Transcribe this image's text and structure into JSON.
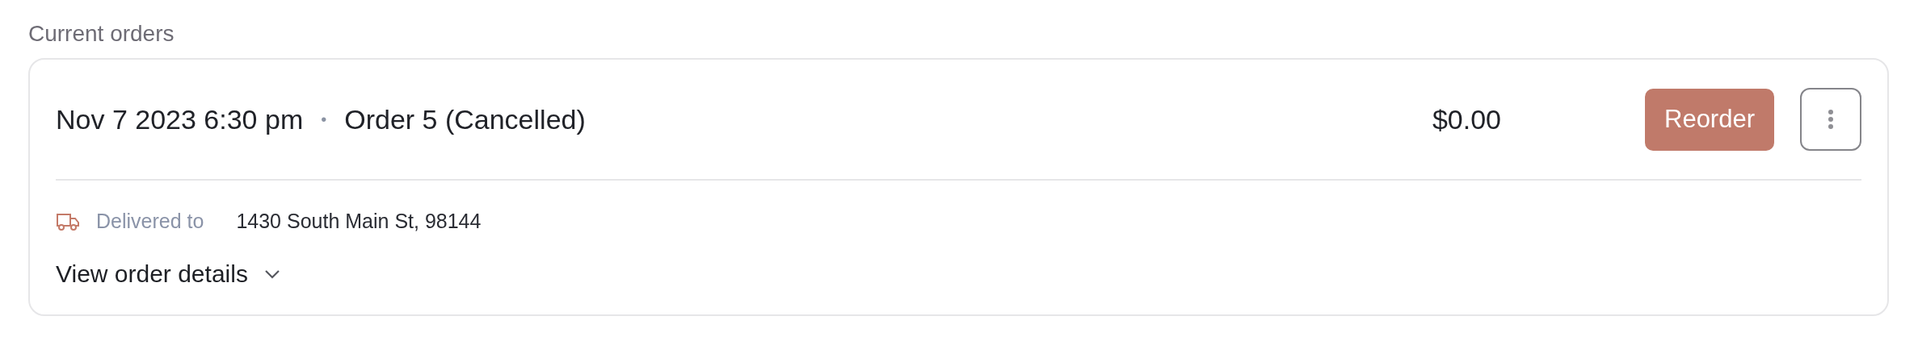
{
  "section_title": "Current orders",
  "order": {
    "date": "Nov 7 2023 6:30 pm",
    "separator": "•",
    "title": "Order 5 (Cancelled)",
    "price": "$0.00",
    "reorder_label": "Reorder",
    "delivery_label": "Delivered to",
    "address": "1430 South Main St, 98144",
    "details_label": "View order details",
    "details_expanded": false
  }
}
